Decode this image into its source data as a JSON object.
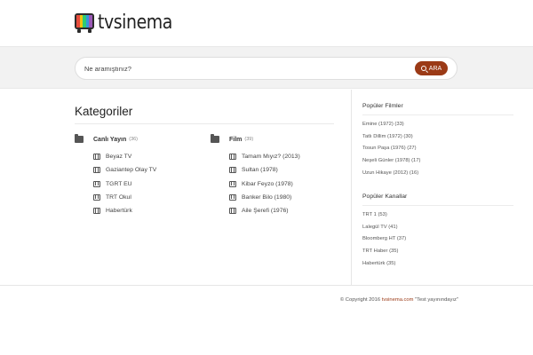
{
  "brand": {
    "logo_text": "tvsinema",
    "logo_colors": [
      "#e74c3c",
      "#f1c40f",
      "#2ecc71",
      "#3498db",
      "#9b59b6"
    ]
  },
  "search": {
    "placeholder": "Ne aramıştınız?",
    "button_label": "ARA",
    "button_color": "#9b3a16"
  },
  "main": {
    "title": "Kategoriler",
    "categories": [
      {
        "name": "Canlı Yayın",
        "count": "(36)",
        "items": [
          "Beyaz TV",
          "Gaziantep Olay TV",
          "TGRT EU",
          "TRT Okul",
          "Habertürk"
        ]
      },
      {
        "name": "Film",
        "count": "(39)",
        "items": [
          "Tamam Mıyız? (2013)",
          "Sultan (1978)",
          "Kibar Feyzo (1978)",
          "Banker Bilo (1980)",
          "Aile Şerefi (1976)"
        ]
      }
    ]
  },
  "sidebar": {
    "films": {
      "title": "Popüler Filmler",
      "items": [
        "Emine (1972) (33)",
        "Tatlı Dillim (1972) (30)",
        "Tosun Paşa (1976) (27)",
        "Neşeli Günler (1978) (17)",
        "Uzun Hikaye (2012) (16)"
      ]
    },
    "channels": {
      "title": "Popüler Kanallar",
      "items": [
        "TRT 1 (53)",
        "Lalegül TV (41)",
        "Bloomberg HT (37)",
        "TRT Haber (35)",
        "Habertürk (35)"
      ]
    }
  },
  "footer": {
    "prefix": "© Copyright 2016 ",
    "link": "tvsinema.com",
    "suffix": " \"Test yayınındayız\""
  }
}
